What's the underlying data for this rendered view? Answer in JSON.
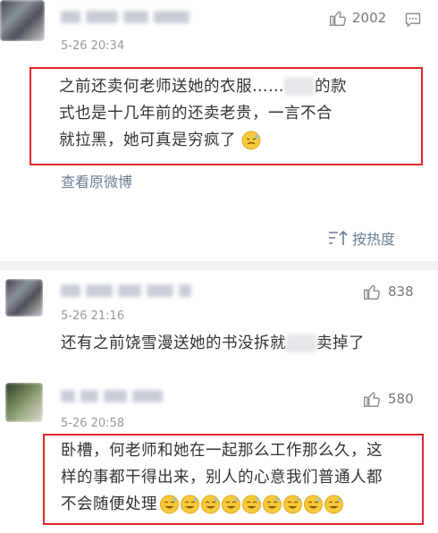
{
  "comments": [
    {
      "time": "5-26 20:34",
      "likes": "2002",
      "text_a": "之前还卖何老师送她的衣服……",
      "text_b": "的款",
      "text_line2": "式也是十几年前的还卖老贵，一言不合",
      "text_line3": "就拉黑，她可真是穷疯了",
      "view_original": "查看原微博"
    },
    {
      "time": "5-26 21:16",
      "likes": "838",
      "text_a": "还有之前饶雪漫送她的书没拆就",
      "text_b": "卖掉了"
    },
    {
      "time": "5-26 20:58",
      "likes": "580",
      "text_line1": "卧槽，何老师和她在一起那么工作那么久，这",
      "text_line2": "样的事都干得出来，别人的心意我们普通人都",
      "text_line3": "不会随便处理"
    }
  ],
  "sort": {
    "label": "按热度"
  },
  "icons": {
    "like": "thumbs-up-icon",
    "comment": "comment-icon",
    "sort": "sort-icon",
    "emoji_sweat": "sweat-smile-emoji",
    "emoji_shy": "embarrassed-emoji"
  },
  "colors": {
    "highlight": "#e0262a",
    "link": "#6d7f95"
  }
}
